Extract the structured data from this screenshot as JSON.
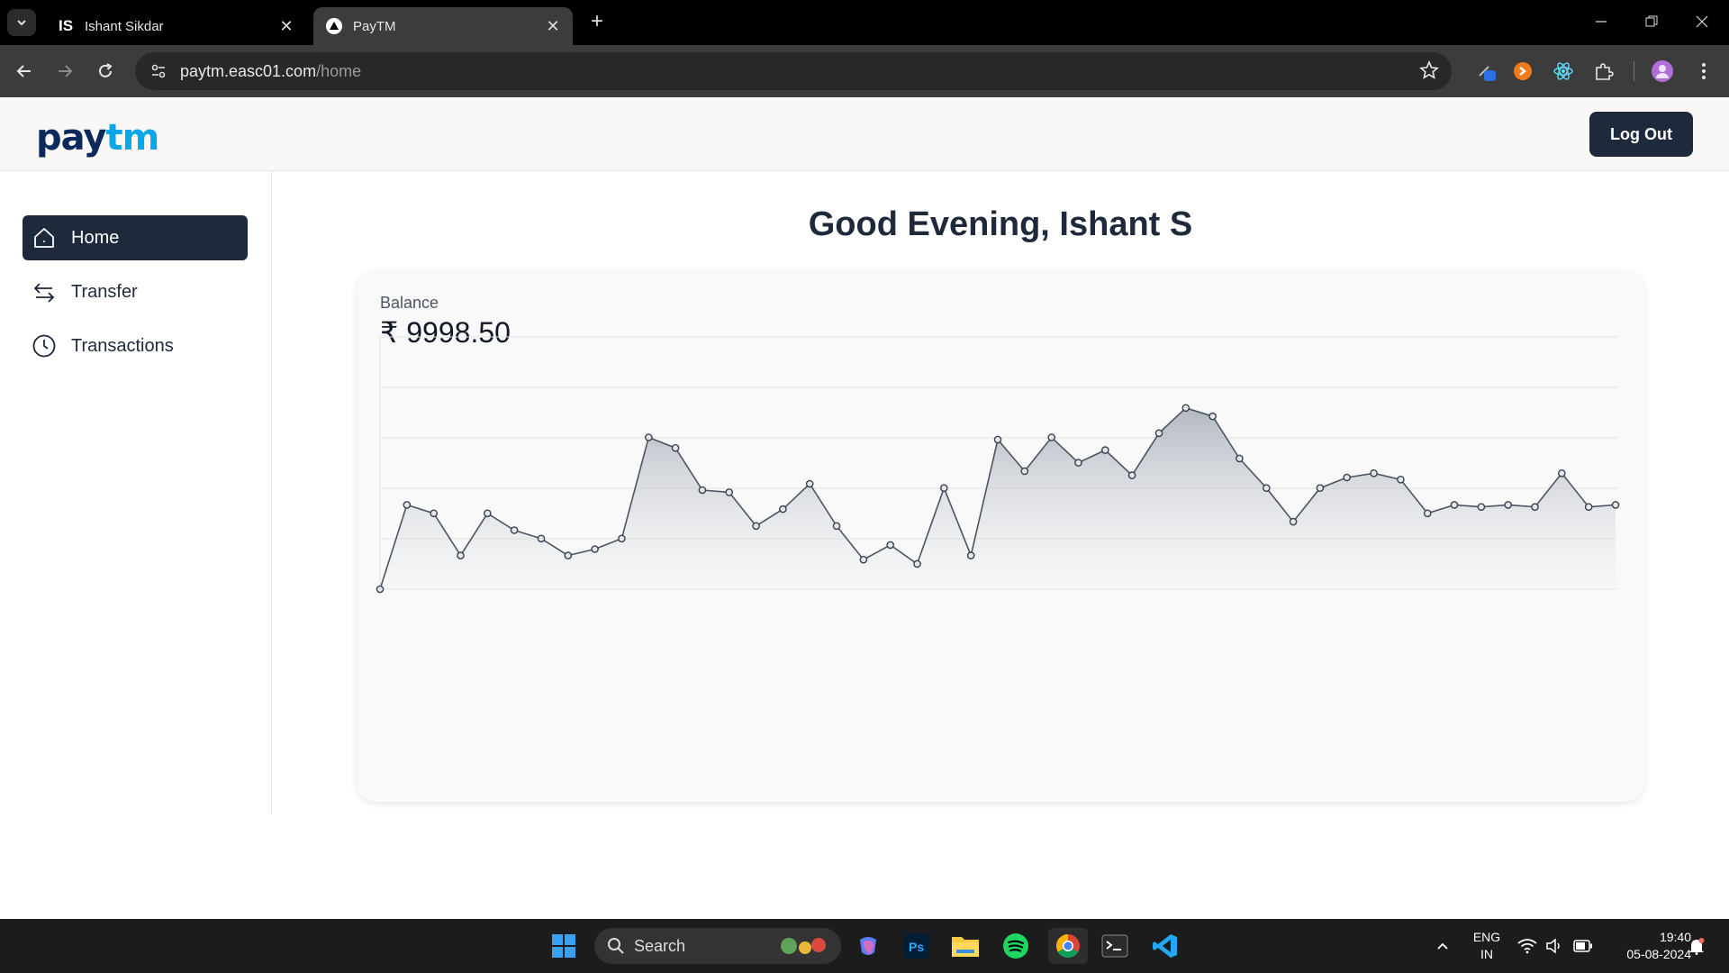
{
  "browser": {
    "tabs": [
      {
        "title": "Ishant Sikdar",
        "favicon_text": "IS",
        "active": false
      },
      {
        "title": "PayTM",
        "active": true
      }
    ],
    "url_host": "paytm.easc01.com",
    "url_path": "/home"
  },
  "app": {
    "logo": {
      "part1": "pay",
      "part2": "tm"
    },
    "logout_label": "Log Out",
    "sidebar": [
      {
        "label": "Home",
        "icon": "home-icon",
        "active": true
      },
      {
        "label": "Transfer",
        "icon": "transfer-arrows-icon",
        "active": false
      },
      {
        "label": "Transactions",
        "icon": "clock-icon",
        "active": false
      }
    ],
    "greeting": "Good Evening, Ishant S",
    "balance": {
      "label": "Balance",
      "currency": "₹",
      "amount": "9998.50"
    }
  },
  "chart_data": {
    "type": "area",
    "title": "",
    "xlabel": "",
    "ylabel": "",
    "grid": true,
    "ylim": [
      0,
      100
    ],
    "series": [
      {
        "values": [
          0,
          40,
          36,
          16,
          36,
          28,
          24,
          16,
          19,
          24,
          72,
          67,
          47,
          46,
          30,
          38,
          50,
          30,
          14,
          21,
          12,
          48,
          16,
          71,
          56,
          72,
          60,
          66,
          54,
          74,
          86,
          82,
          62,
          48,
          32,
          48,
          53,
          55,
          52,
          36,
          40,
          39,
          40,
          39,
          55,
          39,
          40
        ]
      }
    ]
  },
  "taskbar": {
    "search_label": "Search",
    "lang_line1": "ENG",
    "lang_line2": "IN",
    "time": "19:40",
    "date": "05-08-2024"
  }
}
